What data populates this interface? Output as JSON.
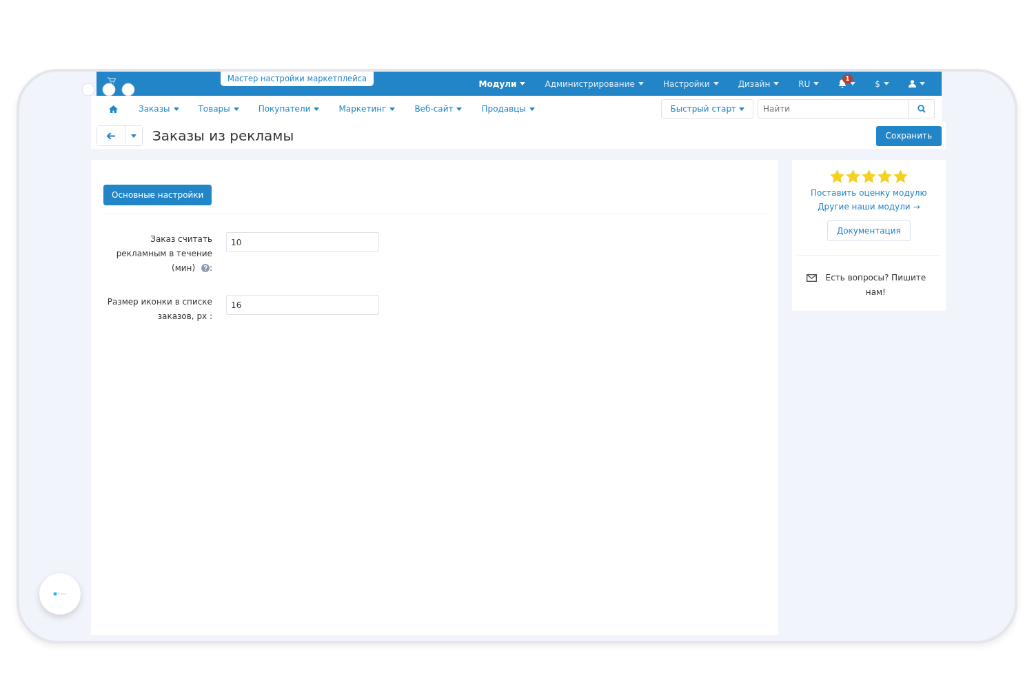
{
  "top_bar": {
    "wizard_tab": "Мастер настройки маркетплейса",
    "menu": [
      {
        "label": "Модули",
        "selected": true
      },
      {
        "label": "Администрирование",
        "selected": false
      },
      {
        "label": "Настройки",
        "selected": false
      },
      {
        "label": "Дизайн",
        "selected": false
      },
      {
        "label": "RU",
        "selected": false
      }
    ],
    "notifications_badge": "1",
    "currency": "$"
  },
  "nav": {
    "items": [
      "Заказы",
      "Товары",
      "Покупатели",
      "Маркетинг",
      "Веб-сайт",
      "Продавцы"
    ],
    "quick_start": "Быстрый старт",
    "search": {
      "placeholder": "Найти"
    }
  },
  "header": {
    "title": "Заказы из рекламы",
    "save_button": "Сохранить"
  },
  "settings": {
    "tab": "Основные настройки",
    "fields": [
      {
        "label": "Заказ считать рекламным в течение (мин)",
        "help": true,
        "colon": ":",
        "value": "10"
      },
      {
        "label": "Размер иконки в списке заказов, px",
        "help": false,
        "colon": ":",
        "value": "16"
      }
    ]
  },
  "sidebar": {
    "stars": 5,
    "rate_link": "Поставить оценку модулю",
    "modules_link": "Другие наши модули →",
    "docs_button": "Документация",
    "contact": "Есть вопросы? Пишите нам!"
  }
}
